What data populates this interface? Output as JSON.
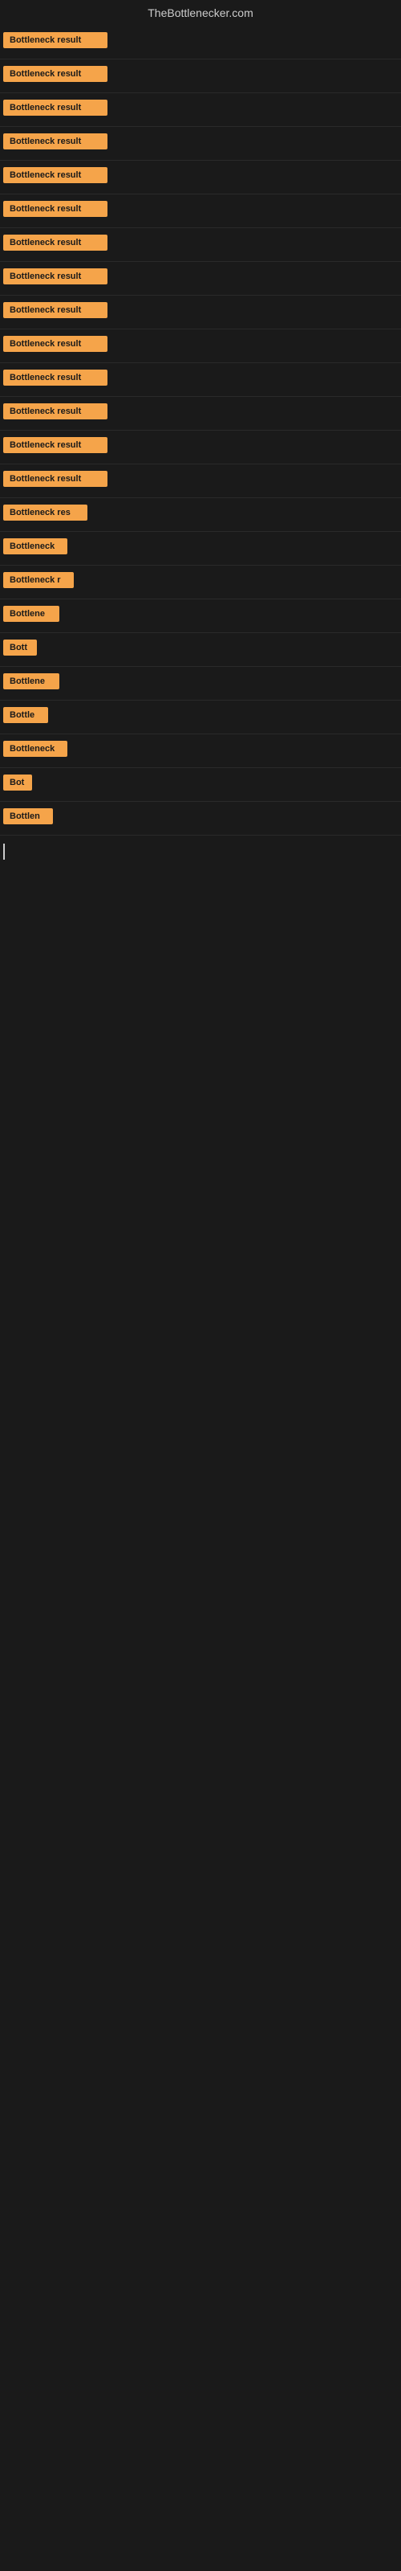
{
  "site": {
    "title": "TheBottlenecker.com"
  },
  "rows": [
    {
      "id": 1,
      "label": "Bottleneck result",
      "width": 130
    },
    {
      "id": 2,
      "label": "Bottleneck result",
      "width": 130
    },
    {
      "id": 3,
      "label": "Bottleneck result",
      "width": 130
    },
    {
      "id": 4,
      "label": "Bottleneck result",
      "width": 130
    },
    {
      "id": 5,
      "label": "Bottleneck result",
      "width": 130
    },
    {
      "id": 6,
      "label": "Bottleneck result",
      "width": 130
    },
    {
      "id": 7,
      "label": "Bottleneck result",
      "width": 130
    },
    {
      "id": 8,
      "label": "Bottleneck result",
      "width": 130
    },
    {
      "id": 9,
      "label": "Bottleneck result",
      "width": 130
    },
    {
      "id": 10,
      "label": "Bottleneck result",
      "width": 130
    },
    {
      "id": 11,
      "label": "Bottleneck result",
      "width": 130
    },
    {
      "id": 12,
      "label": "Bottleneck result",
      "width": 130
    },
    {
      "id": 13,
      "label": "Bottleneck result",
      "width": 130
    },
    {
      "id": 14,
      "label": "Bottleneck result",
      "width": 130
    },
    {
      "id": 15,
      "label": "Bottleneck res",
      "width": 105
    },
    {
      "id": 16,
      "label": "Bottleneck",
      "width": 80
    },
    {
      "id": 17,
      "label": "Bottleneck r",
      "width": 88
    },
    {
      "id": 18,
      "label": "Bottlene",
      "width": 70
    },
    {
      "id": 19,
      "label": "Bott",
      "width": 42
    },
    {
      "id": 20,
      "label": "Bottlene",
      "width": 70
    },
    {
      "id": 21,
      "label": "Bottle",
      "width": 56
    },
    {
      "id": 22,
      "label": "Bottleneck",
      "width": 80
    },
    {
      "id": 23,
      "label": "Bot",
      "width": 36
    },
    {
      "id": 24,
      "label": "Bottlen",
      "width": 62
    }
  ],
  "colors": {
    "badge_bg": "#f5a44a",
    "badge_text": "#1a1a1a",
    "body_bg": "#1a1a1a",
    "title_color": "#cccccc"
  }
}
